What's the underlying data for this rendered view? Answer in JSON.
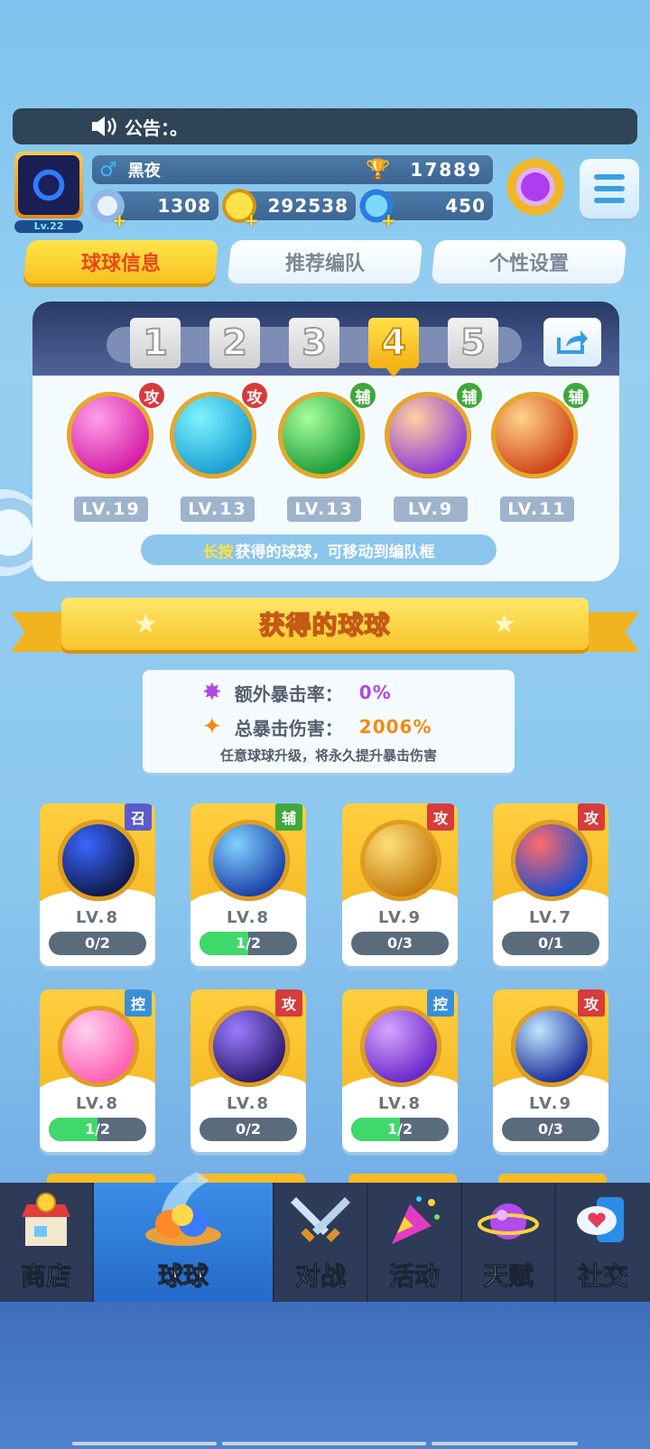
{
  "announcement": {
    "label": "公告：。"
  },
  "player": {
    "name": "黑夜",
    "level": "Lv.22",
    "trophies": "17889",
    "energy": "1308",
    "coins": "292538",
    "gems": "450"
  },
  "tabs": [
    {
      "label": "球球信息",
      "active": true
    },
    {
      "label": "推荐编队",
      "active": false
    },
    {
      "label": "个性设置",
      "active": false
    }
  ],
  "team": {
    "slots": [
      "1",
      "2",
      "3",
      "4",
      "5"
    ],
    "active_slot": "4",
    "balls": [
      {
        "type": "攻",
        "level": "LV.19",
        "colors": [
          "#ff9fe8",
          "#d41ea8"
        ]
      },
      {
        "type": "攻",
        "level": "LV.13",
        "colors": [
          "#7ff2ff",
          "#1a9fd3"
        ]
      },
      {
        "type": "辅",
        "level": "LV.13",
        "colors": [
          "#a6ff9a",
          "#1f9c3a"
        ]
      },
      {
        "type": "辅",
        "level": "LV.9",
        "colors": [
          "#ffd0a0",
          "#8f3dd6"
        ]
      },
      {
        "type": "辅",
        "level": "LV.11",
        "colors": [
          "#ffd38a",
          "#d0451a"
        ]
      }
    ],
    "hint_highlight": "长按",
    "hint_text": "获得的球球，可移动到编队框"
  },
  "owned": {
    "title": "获得的球球",
    "extra_crit_label": "额外暴击率：",
    "extra_crit_value": "0%",
    "total_crit_label": "总暴击伤害：",
    "total_crit_value": "2006%",
    "note": "任意球球升级，将永久提升暴击伤害",
    "cards": [
      {
        "type": "召",
        "level": "LV.8",
        "progress": "0/2",
        "fill": 0,
        "colors": [
          "#3a66ff",
          "#101a4a"
        ]
      },
      {
        "type": "辅",
        "level": "LV.8",
        "progress": "1/2",
        "fill": 0.5,
        "colors": [
          "#7fd2ff",
          "#1b3fa8"
        ]
      },
      {
        "type": "攻",
        "level": "LV.9",
        "progress": "0/3",
        "fill": 0,
        "colors": [
          "#ffe07a",
          "#c47b12"
        ]
      },
      {
        "type": "攻",
        "level": "LV.7",
        "progress": "0/1",
        "fill": 0,
        "colors": [
          "#ff6a6a",
          "#1b4fd0"
        ]
      },
      {
        "type": "控",
        "level": "LV.8",
        "progress": "1/2",
        "fill": 0.5,
        "colors": [
          "#ffd0f0",
          "#ff5fb4"
        ]
      },
      {
        "type": "攻",
        "level": "LV.8",
        "progress": "0/2",
        "fill": 0,
        "colors": [
          "#9a7cff",
          "#2c1a6e"
        ]
      },
      {
        "type": "控",
        "level": "LV.8",
        "progress": "1/2",
        "fill": 0.5,
        "colors": [
          "#d7a4ff",
          "#6a27c9"
        ]
      },
      {
        "type": "攻",
        "level": "LV.9",
        "progress": "0/3",
        "fill": 0,
        "colors": [
          "#bfe5ff",
          "#1b2f9a"
        ]
      }
    ]
  },
  "nav": [
    {
      "label": "商店",
      "icon": "shop-icon",
      "active": false
    },
    {
      "label": "球球",
      "icon": "balls-icon",
      "active": true
    },
    {
      "label": "对战",
      "icon": "battle-icon",
      "active": false
    },
    {
      "label": "活动",
      "icon": "event-icon",
      "active": false
    },
    {
      "label": "天赋",
      "icon": "talent-icon",
      "active": false
    },
    {
      "label": "社交",
      "icon": "social-icon",
      "active": false
    }
  ]
}
